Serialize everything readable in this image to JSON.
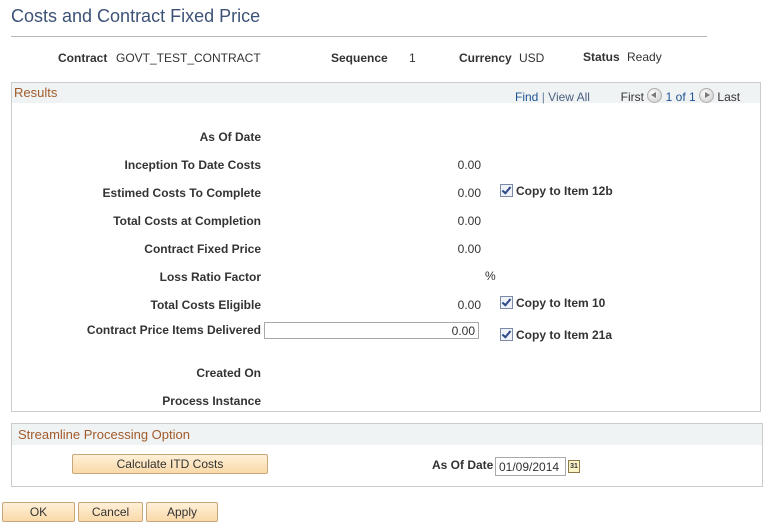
{
  "page": {
    "title": "Costs and Contract Fixed Price"
  },
  "header": {
    "contract_label": "Contract",
    "contract_value": "GOVT_TEST_CONTRACT",
    "sequence_label": "Sequence",
    "sequence_value": "1",
    "currency_label": "Currency",
    "currency_value": "USD",
    "status_label": "Status",
    "status_value": "Ready"
  },
  "results": {
    "title": "Results",
    "nav": {
      "find": "Find",
      "sep": "|",
      "view_all": "View All",
      "first": "First",
      "count": "1 of 1",
      "last": "Last"
    },
    "fields": {
      "as_of_date_label": "As Of Date",
      "itd_costs_label": "Inception To Date Costs",
      "itd_costs_value": "0.00",
      "estimated_label": "Estimed Costs To Complete",
      "estimated_value": "0.00",
      "total_completion_label": "Total Costs at Completion",
      "total_completion_value": "0.00",
      "fixed_price_label": "Contract Fixed Price",
      "fixed_price_value": "0.00",
      "loss_ratio_label": "Loss Ratio Factor",
      "loss_ratio_unit": "%",
      "eligible_label": "Total Costs Eligible",
      "eligible_value": "0.00",
      "delivered_label": "Contract Price Items Delivered",
      "delivered_value": "0.00",
      "created_on_label": "Created On",
      "process_instance_label": "Process Instance"
    },
    "checkboxes": {
      "copy_12b": {
        "label": "Copy to Item 12b",
        "checked": true
      },
      "copy_10": {
        "label": "Copy to Item 10",
        "checked": true
      },
      "copy_21a": {
        "label": "Copy to Item 21a",
        "checked": true
      }
    }
  },
  "streamline": {
    "title": "Streamline Processing Option",
    "calculate_button": "Calculate ITD Costs",
    "as_of_date_label": "As Of Date",
    "as_of_date_value": "01/09/2014",
    "calendar_icon_text": "31"
  },
  "footer": {
    "ok": "OK",
    "cancel": "Cancel",
    "apply": "Apply"
  }
}
